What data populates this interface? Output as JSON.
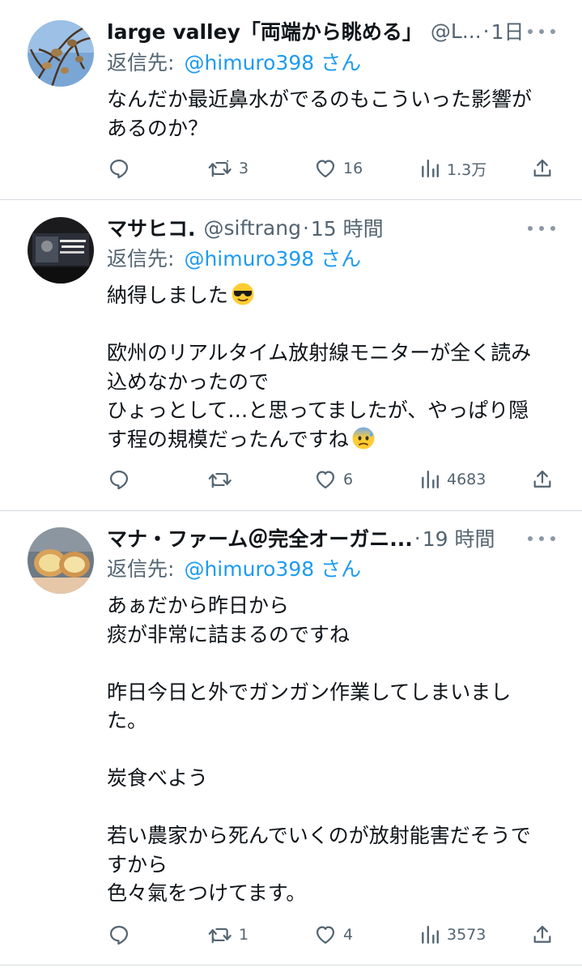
{
  "tweets": [
    {
      "name": "large valley「両端から眺める」",
      "handle": "@L...",
      "dot": "·",
      "time": "1日",
      "reply_prefix": "返信先:",
      "reply_to": "@himuro398 さん",
      "paragraphs": [
        "なんだか最近鼻水がでるのもこういった影響が\nあるのか？"
      ],
      "retweets": "3",
      "likes": "16",
      "views": "1.3万"
    },
    {
      "name": "マサヒコ.",
      "handle": "@siftrang",
      "dot": "·",
      "time": "15 時間",
      "reply_prefix": "返信先:",
      "reply_to": "@himuro398 さん",
      "paragraphs": [
        "納得しました",
        "欧州のリアルタイム放射線モニターが全く読み\n込めなかったので\nひょっとして…と思ってましたが、やっぱり隠\nす程の規模だったんですね"
      ],
      "emojis": [
        "sunglasses-face",
        "anxious-face-with-sweat"
      ],
      "retweets": "",
      "likes": "6",
      "views": "4683"
    },
    {
      "name": "マナ・ファーム＠完全オーガニ...",
      "handle": "",
      "dot": "·",
      "time": "19 時間",
      "reply_prefix": "返信先:",
      "reply_to": "@himuro398 さん",
      "paragraphs": [
        "あぁだから昨日から\n痰が非常に詰まるのですね",
        "昨日今日と外でガンガン作業してしまいまし\nた。",
        "炭食べよう",
        "若い農家から死んでいくのが放射能害だそうで\nすから\n色々氣をつけてます。"
      ],
      "retweets": "1",
      "likes": "4",
      "views": "3573"
    }
  ],
  "colors": {
    "text": "#0f1419",
    "secondary": "#536471",
    "link": "#1d9bf0",
    "divider": "#d5dadf"
  }
}
